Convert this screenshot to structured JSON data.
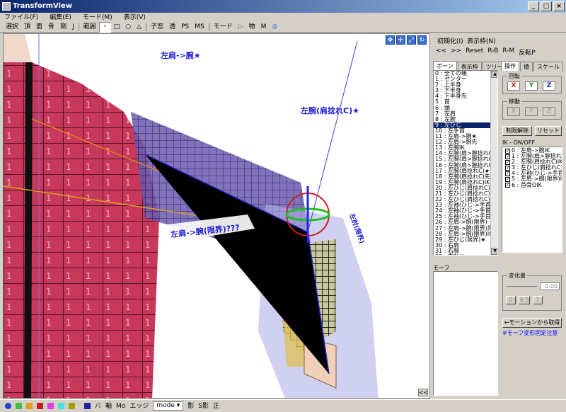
{
  "window": {
    "title": "TransformView",
    "min": "_",
    "max": "□",
    "close": "×"
  },
  "menu": [
    "ファイル(F)",
    "編集(E)",
    "モード(M)",
    "表示(V)"
  ],
  "toolbar": [
    "選択",
    "頂",
    "面",
    "骨",
    "剛",
    "J",
    "範囲",
    "・",
    "□",
    "○",
    "△",
    "子窓",
    "透",
    "PS",
    "MS",
    "モード",
    "▷",
    "物",
    "M",
    "◎"
  ],
  "viewport": {
    "icons": [
      "✥",
      "✛",
      "⤢",
      "↻"
    ],
    "collapse": "<<",
    "labels": [
      "左肩->腕★",
      "左腕(肩捻れC)★",
      "左肩->腕(限界)???",
      "左肘(限界)"
    ]
  },
  "statusbar": {
    "items": [
      "軸",
      "Mo",
      "エッジ",
      "mode",
      "影",
      "S影",
      "正"
    ],
    "mode": "mode ▾",
    "flip": "ﾉﾐ"
  },
  "panel": {
    "init": "初期化(I)",
    "display": "表示枠(N)",
    "nav": [
      "<<",
      ">>",
      "Reset",
      "R-B",
      "R-M",
      "反転P"
    ],
    "tabs": [
      "ボーン",
      "表示枠",
      "ツリー"
    ],
    "bones": [
      "0 : 全ての親",
      "1 : センター",
      "2 : 上半身",
      "3 : 下半身",
      "4 : 下半身先",
      "5 : 首",
      "6 : 頭",
      "7 : 左肩",
      "8 : 左腕",
      "9 : 左ひじ",
      "10 : 左手首",
      "11 : 左肩->腕★",
      "12 : 左肩->腕先",
      "13 : 左腕IK",
      "14 : 左腕(肩>腕捻れC)",
      "15 : 左腕(肩>腕捻れC)",
      "16 : 左腕(肩>腕捻れC)",
      "17 : 左腕(肩捻れC)★",
      "18 : 左腕(肩捻れC)先",
      "19 : 左腕(肩捻れC)IK",
      "20 : 左ひじ(肩捻れC)★",
      "21 : 左ひじ(肩捻れC)先",
      "22 : 左ひじ(肩捻れC)IK",
      "23 : 左袖(ひじ->手首)★",
      "24 : 左袖(ひじ->手首)先",
      "25 : 左袖(ひじ->手首)IK",
      "26 : 左肩->腕(限界)",
      "27 : 左肩->腕(限界)先",
      "28 : 左肩->腕(限界)IK",
      "29 : 左ひじ(限界)★",
      "30 : 右肩",
      "31 : 右腕",
      "32 : 右ひじ"
    ],
    "selected": 9,
    "optabs": [
      "操作",
      "値",
      "スケール"
    ],
    "rotate": "回転",
    "move": "移動",
    "axes": [
      "X",
      "Y",
      "Z"
    ],
    "unlock": "制限解除",
    "reset": "リセット",
    "ik_title": "IK - ON/OFF",
    "ik": [
      "0 : 左肩->腕IK",
      "1 : 左腕(肩>腕捻れC)IK",
      "2 : 左腕(肩捻れC)IK",
      "3 : 左ひじ(肩捻れC)IK",
      "4 : 左袖(ひじ->手首)IK",
      "5 : 左肩->腕(限界)IK",
      "6 : 首骨OIK"
    ],
    "morph": "モーフ",
    "change": "変化量",
    "value": "0.00",
    "presets": [
      "0",
      "0.5",
      "1"
    ],
    "get_motion": "←モーションから取得",
    "note": "※モーフ変形固定注意"
  },
  "colors": {
    "titlebar": "#0a246a",
    "shirt": "#c8385a",
    "tube": "#5a4a9c",
    "label": "#1a1ad6"
  }
}
